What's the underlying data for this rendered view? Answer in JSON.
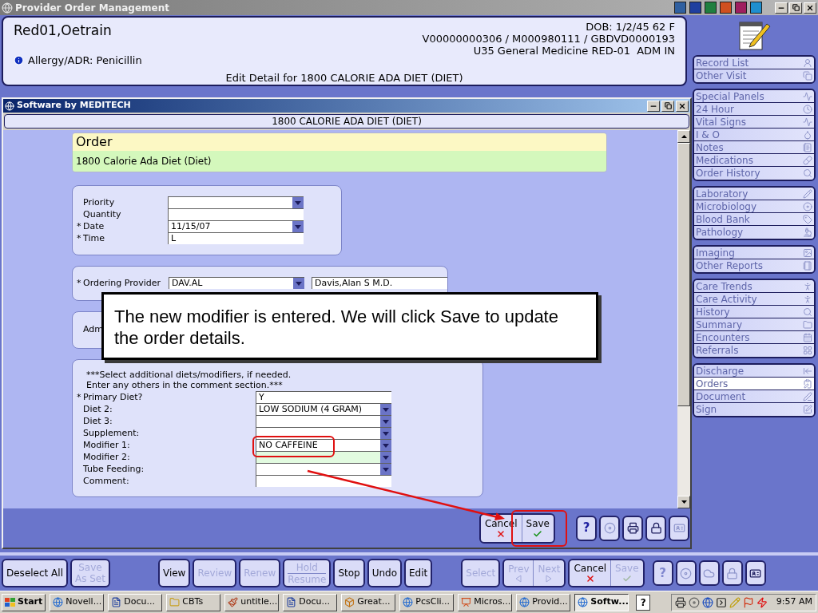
{
  "window": {
    "title": "Provider Order Management"
  },
  "patient": {
    "name": "Red01,Oetrain",
    "dob": "DOB: 1/2/45 62 F",
    "account": "V00000000306 / M000980111 / GBDVD0000193",
    "location": "U35 General Medicine RED-01  ADM IN",
    "allergy": "Allergy/ADR: Penicillin",
    "context": "Edit Detail for 1800 CALORIE ADA DIET (DIET)"
  },
  "dialog": {
    "title": "Software by MEDITECH",
    "heading": "1800 CALORIE ADA DIET (DIET)",
    "order": {
      "title": "Order",
      "description": "1800 Calorie Ada Diet (Diet)"
    },
    "sections": [
      {
        "kind": "details",
        "fields": [
          {
            "label": "Priority",
            "kind": "select"
          },
          {
            "label": "Quantity",
            "kind": "text"
          },
          {
            "mark": "*",
            "label": "Date",
            "kind": "select",
            "value": "11/15/07"
          },
          {
            "mark": "*",
            "label": "Time",
            "kind": "text",
            "value": "L"
          }
        ]
      },
      {
        "kind": "provider",
        "fields": [
          {
            "mark": "*",
            "label": "Ordering Provider",
            "kind": "select",
            "value": "DAV.AL"
          },
          {
            "kind": "text",
            "value": "Davis,Alan S M.D."
          }
        ]
      },
      {
        "kind": "covered",
        "label": "Adm"
      },
      {
        "kind": "diet",
        "instructions": [
          "***Select additional diets/modifiers, if needed.",
          "Enter any others in the comment section.***"
        ],
        "fields": [
          {
            "mark": "*",
            "label": "Primary Diet?",
            "kind": "text",
            "value": "Y"
          },
          {
            "label": "Diet 2:",
            "kind": "select",
            "value": "LOW SODIUM (4 GRAM)"
          },
          {
            "label": "Diet 3:",
            "kind": "select"
          },
          {
            "label": "Supplement:",
            "kind": "select"
          },
          {
            "label": "Modifier 1:",
            "kind": "select",
            "value": "NO CAFFEINE"
          },
          {
            "label": "Modifier 2:",
            "kind": "select",
            "highlighted": true
          },
          {
            "label": "Tube Feeding:",
            "kind": "select"
          },
          {
            "label": "Comment:",
            "kind": "text"
          }
        ]
      }
    ],
    "buttons": [
      {
        "kind": "cancel",
        "label": "Cancel",
        "disabled": false
      },
      {
        "kind": "save",
        "label": "Save",
        "disabled": false
      }
    ],
    "tools": [
      {
        "kind": "help",
        "label": "?",
        "disabled": false
      },
      {
        "kind": "disc",
        "disabled": true
      },
      {
        "kind": "printer",
        "disabled": false
      },
      {
        "kind": "lock",
        "disabled": false
      },
      {
        "kind": "card",
        "disabled": true
      }
    ]
  },
  "callout": "The new modifier is entered. We will click Save to update the order details.",
  "sidebar": {
    "groups": [
      {
        "items": [
          {
            "label": "Record List",
            "selected": false
          },
          {
            "label": "Other Visit",
            "selected": false
          }
        ]
      },
      {
        "items": [
          {
            "label": "Special Panels",
            "selected": false
          },
          {
            "label": "24 Hour",
            "selected": false
          },
          {
            "label": "Vital Signs",
            "selected": false
          },
          {
            "label": "I & O",
            "selected": false
          },
          {
            "label": "Notes",
            "selected": false
          },
          {
            "label": "Medications",
            "selected": false
          },
          {
            "label": "Order History",
            "selected": false
          }
        ]
      },
      {
        "items": [
          {
            "label": "Laboratory",
            "selected": false
          },
          {
            "label": "Microbiology",
            "selected": false
          },
          {
            "label": "Blood Bank",
            "selected": false
          },
          {
            "label": "Pathology",
            "selected": false
          }
        ]
      },
      {
        "items": [
          {
            "label": "Imaging",
            "selected": false
          },
          {
            "label": "Other Reports",
            "selected": false
          }
        ]
      },
      {
        "items": [
          {
            "label": "Care Trends",
            "selected": false
          },
          {
            "label": "Care Activity",
            "selected": false
          },
          {
            "label": "History",
            "selected": false
          },
          {
            "label": "Summary",
            "selected": false
          },
          {
            "label": "Encounters",
            "selected": false
          },
          {
            "label": "Referrals",
            "selected": false
          }
        ]
      },
      {
        "items": [
          {
            "label": "Discharge",
            "selected": false
          },
          {
            "label": "Orders",
            "selected": true
          },
          {
            "label": "Document",
            "selected": false
          },
          {
            "label": "Sign",
            "selected": false
          }
        ]
      }
    ]
  },
  "toolbar": {
    "groups": [
      {
        "buttons": [
          {
            "kind": "text",
            "label": "Deselect All",
            "disabled": false
          },
          {
            "kind": "stacked",
            "lines": [
              "Save",
              "As Set"
            ],
            "disabled": true
          }
        ]
      },
      {
        "buttons": [
          {
            "kind": "text",
            "label": "View",
            "disabled": false
          },
          {
            "kind": "text",
            "label": "Review",
            "disabled": true
          },
          {
            "kind": "text",
            "label": "Renew",
            "disabled": true
          },
          {
            "kind": "split",
            "lines": [
              "Hold",
              "Resume"
            ],
            "disabled": true
          },
          {
            "kind": "text",
            "label": "Stop",
            "disabled": false
          },
          {
            "kind": "text",
            "label": "Undo",
            "disabled": false
          },
          {
            "kind": "text",
            "label": "Edit",
            "disabled": false
          }
        ]
      },
      {
        "buttons": [
          {
            "kind": "text",
            "label": "Select",
            "disabled": true
          },
          {
            "kind": "pair",
            "buttons": [
              {
                "kind": "prev",
                "label": "Prev",
                "disabled": true
              },
              {
                "kind": "next",
                "label": "Next",
                "disabled": true
              }
            ]
          },
          {
            "kind": "pair",
            "buttons": [
              {
                "kind": "cancel",
                "label": "Cancel",
                "disabled": false
              },
              {
                "kind": "save",
                "label": "Save",
                "disabled": true
              }
            ]
          }
        ]
      },
      {
        "buttons": [
          {
            "kind": "help",
            "label": "?",
            "disabled": true
          },
          {
            "kind": "disc",
            "disabled": true
          },
          {
            "kind": "cloud",
            "disabled": true
          },
          {
            "kind": "lock",
            "disabled": true
          },
          {
            "kind": "card",
            "disabled": false
          }
        ]
      }
    ]
  },
  "taskbar": {
    "start": "Start",
    "tasks": [
      {
        "label": "Novell...",
        "selected": false
      },
      {
        "label": "Docu...",
        "selected": false
      },
      {
        "label": "CBTs",
        "selected": false
      },
      {
        "label": "untitle...",
        "selected": false
      },
      {
        "label": "Docu...",
        "selected": false
      },
      {
        "label": "Great...",
        "selected": false
      },
      {
        "label": "PcsCli...",
        "selected": false
      },
      {
        "label": "Micros...",
        "selected": false
      },
      {
        "label": "Provid...",
        "selected": false
      },
      {
        "label": "Softw...",
        "selected": true
      }
    ],
    "help": "?",
    "clock": "9:57 AM"
  }
}
